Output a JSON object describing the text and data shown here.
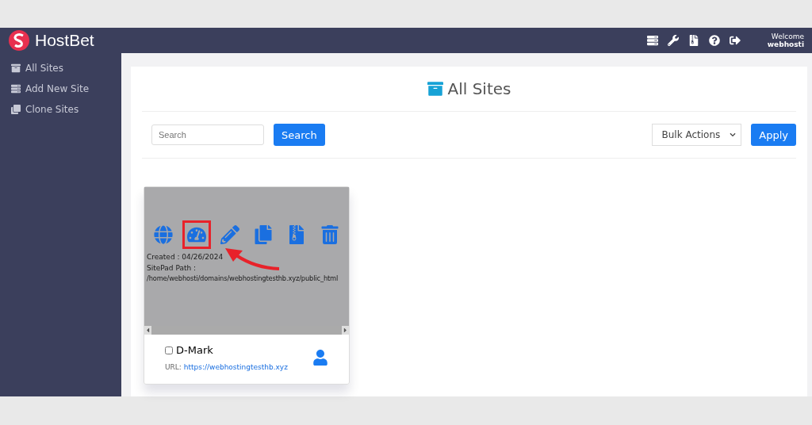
{
  "header": {
    "brand": "HostBet",
    "welcome": "Welcome",
    "username": "webhosti"
  },
  "sidebar": {
    "items": [
      {
        "label": "All Sites",
        "kind": "archive"
      },
      {
        "label": "Add New Site",
        "kind": "add"
      },
      {
        "label": "Clone Sites",
        "kind": "clone"
      }
    ]
  },
  "page": {
    "title": "All Sites"
  },
  "toolbar": {
    "search_placeholder": "Search",
    "search_button": "Search",
    "bulk_select": "Bulk Actions",
    "apply_button": "Apply"
  },
  "sites": [
    {
      "name": "D-Mark",
      "checked": false,
      "url_label": "URL:",
      "url": "https://webhostingtesthb.xyz",
      "created": "Created : 04/26/2024",
      "path_label": "SitePad Path :",
      "path": "/home/webhosti/domains/webhostingtesthb.xyz/public_html",
      "actions": [
        {
          "kind": "globe",
          "highlighted": false
        },
        {
          "kind": "dashboard",
          "highlighted": true
        },
        {
          "kind": "edit",
          "highlighted": false
        },
        {
          "kind": "copy",
          "highlighted": false
        },
        {
          "kind": "zip",
          "highlighted": false
        },
        {
          "kind": "trash",
          "highlighted": false
        }
      ]
    }
  ]
}
